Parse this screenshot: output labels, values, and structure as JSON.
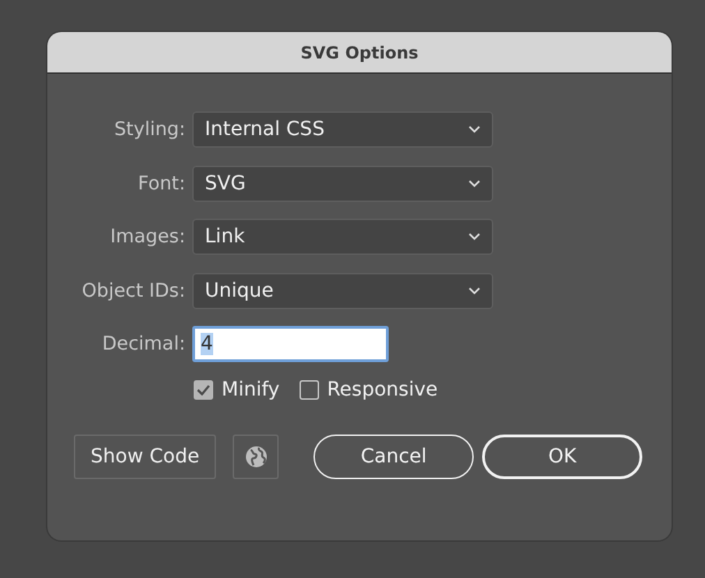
{
  "dialog": {
    "title": "SVG Options"
  },
  "dropdowns": [
    {
      "label": "Styling:",
      "value": "Internal CSS"
    },
    {
      "label": "Font:",
      "value": "SVG"
    },
    {
      "label": "Images:",
      "value": "Link"
    },
    {
      "label": "Object IDs:",
      "value": "Unique"
    }
  ],
  "decimal": {
    "label": "Decimal:",
    "value": "4",
    "highlighted": true
  },
  "checkboxes": [
    {
      "label": "Minify",
      "checked": true
    },
    {
      "label": "Responsive",
      "checked": false
    }
  ],
  "buttons": [
    {
      "kind": "plain",
      "label": "Show Code"
    },
    {
      "kind": "icon"
    },
    {
      "kind": "pill",
      "label": "Cancel",
      "default": false
    },
    {
      "kind": "pill",
      "label": "OK",
      "default": true
    }
  ]
}
